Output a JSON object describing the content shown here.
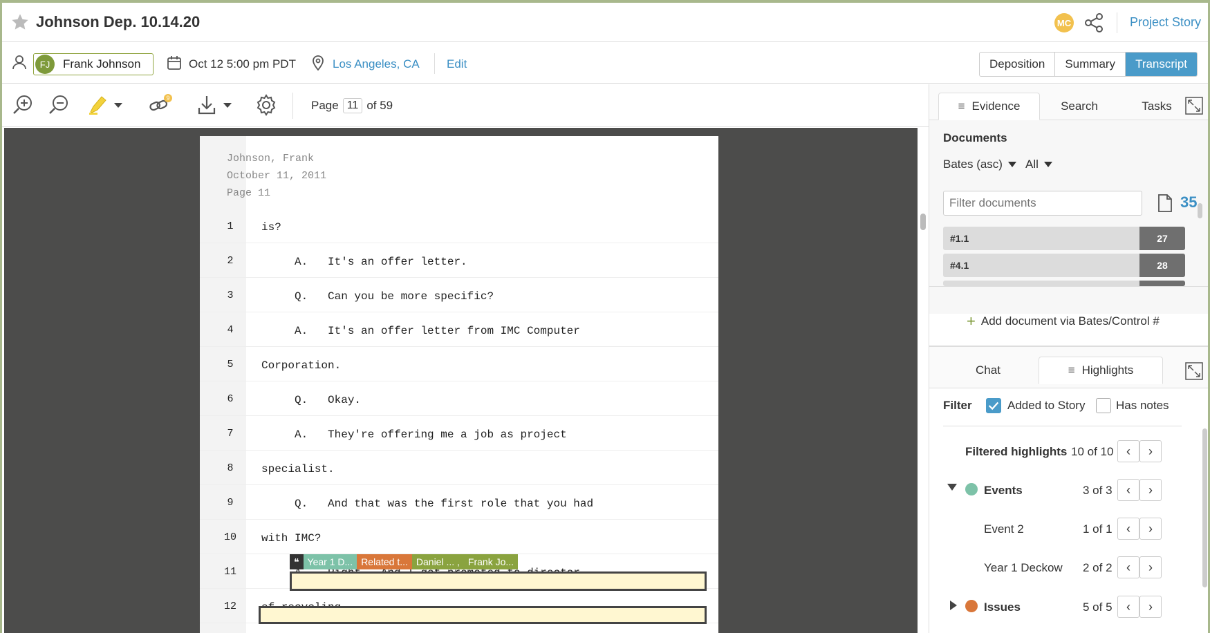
{
  "title": "Johnson Dep. 10.14.20",
  "user_initials": "MC",
  "project_story": "Project Story",
  "witness": {
    "initials": "FJ",
    "name": "Frank Johnson"
  },
  "date": "Oct 12 5:00 pm PDT",
  "location": "Los Angeles, CA",
  "edit": "Edit",
  "view_tabs": [
    "Deposition",
    "Summary",
    "Transcript"
  ],
  "active_view": "Transcript",
  "toolbar": {
    "link_badge": "9",
    "page_prefix": "Page",
    "page_current": "11",
    "page_suffix": "of 59"
  },
  "transcript": {
    "header": [
      "Johnson, Frank",
      "October 11, 2011",
      "Page 11"
    ],
    "lines": [
      {
        "n": "1",
        "text": "is?"
      },
      {
        "n": "2",
        "text": "     A.   It's an offer letter."
      },
      {
        "n": "3",
        "text": "     Q.   Can you be more specific?"
      },
      {
        "n": "4",
        "text": "     A.   It's an offer letter from IMC Computer"
      },
      {
        "n": "5",
        "text": "Corporation."
      },
      {
        "n": "6",
        "text": "     Q.   Okay."
      },
      {
        "n": "7",
        "text": "     A.   They're offering me a job as project"
      },
      {
        "n": "8",
        "text": "specialist."
      },
      {
        "n": "9",
        "text": "     Q.   And that was the first role that you had"
      },
      {
        "n": "10",
        "text": "with IMC?"
      },
      {
        "n": "11",
        "text": "     A.   Right.  And I got promoted to director"
      },
      {
        "n": "12",
        "text": "of recycling."
      }
    ],
    "highlight_tags": [
      {
        "label": "❝",
        "color": "#333333"
      },
      {
        "label": "Year 1 D...",
        "color": "#7dc2a8"
      },
      {
        "label": "Related t...",
        "color": "#d9773a"
      },
      {
        "label": "Daniel ...   ,",
        "color": "#8aa33f"
      },
      {
        "label": "Frank Jo...",
        "color": "#8aa33f"
      }
    ]
  },
  "panel": {
    "tabs": [
      "Evidence",
      "Search",
      "Tasks"
    ],
    "active_tab": "Evidence",
    "documents_title": "Documents",
    "sort": "Bates (asc)",
    "filter_all": "All",
    "filter_placeholder": "Filter documents",
    "doc_count": "35",
    "docs": [
      {
        "label": "#1.1",
        "count": "27"
      },
      {
        "label": "#4.1",
        "count": "28"
      }
    ],
    "add_doc": "Add document via Bates/Control #",
    "tabs2": [
      "Chat",
      "Highlights"
    ],
    "active_tab2": "Highlights",
    "filter_label": "Filter",
    "added_to_story": "Added to Story",
    "has_notes": "Has notes",
    "filtered_label": "Filtered highlights",
    "filtered_count": "10 of 10",
    "groups": [
      {
        "name": "Events",
        "count": "3 of 3",
        "color": "#7dc2a8",
        "expanded": true,
        "items": [
          {
            "name": "Event 2",
            "count": "1 of 1"
          },
          {
            "name": "Year 1 Deckow",
            "count": "2 of 2"
          }
        ]
      },
      {
        "name": "Issues",
        "count": "5 of 5",
        "color": "#d9773a",
        "expanded": false,
        "items": []
      }
    ]
  }
}
